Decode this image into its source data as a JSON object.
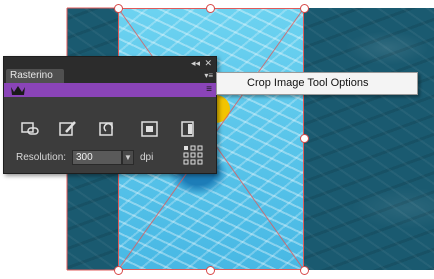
{
  "panel": {
    "title": "Rasterino",
    "collapse_glyph": "◂◂",
    "close_glyph": "✕",
    "tab_menu_glyph": "▾≡",
    "bar_menu_glyph": "≡",
    "logo_icon": "crown-icon",
    "tools": [
      "link-image-icon",
      "brush-image-icon",
      "rotate-image-icon",
      "crop-image-icon",
      "split-image-icon"
    ],
    "resolution": {
      "label": "Resolution:",
      "value": "300",
      "dropdown_glyph": "▼",
      "unit": "dpi"
    },
    "grid_icon": "reference-point-grid-icon"
  },
  "context_menu": {
    "items": [
      {
        "label": "Crop Image Tool Options"
      }
    ]
  },
  "colors": {
    "panel_bg": "#3c3c3c",
    "accent_purple": "#8a44b8",
    "crop_frame": "#e05a5a",
    "water_inside": "#48b8e4",
    "water_outside": "#1a5a70"
  }
}
